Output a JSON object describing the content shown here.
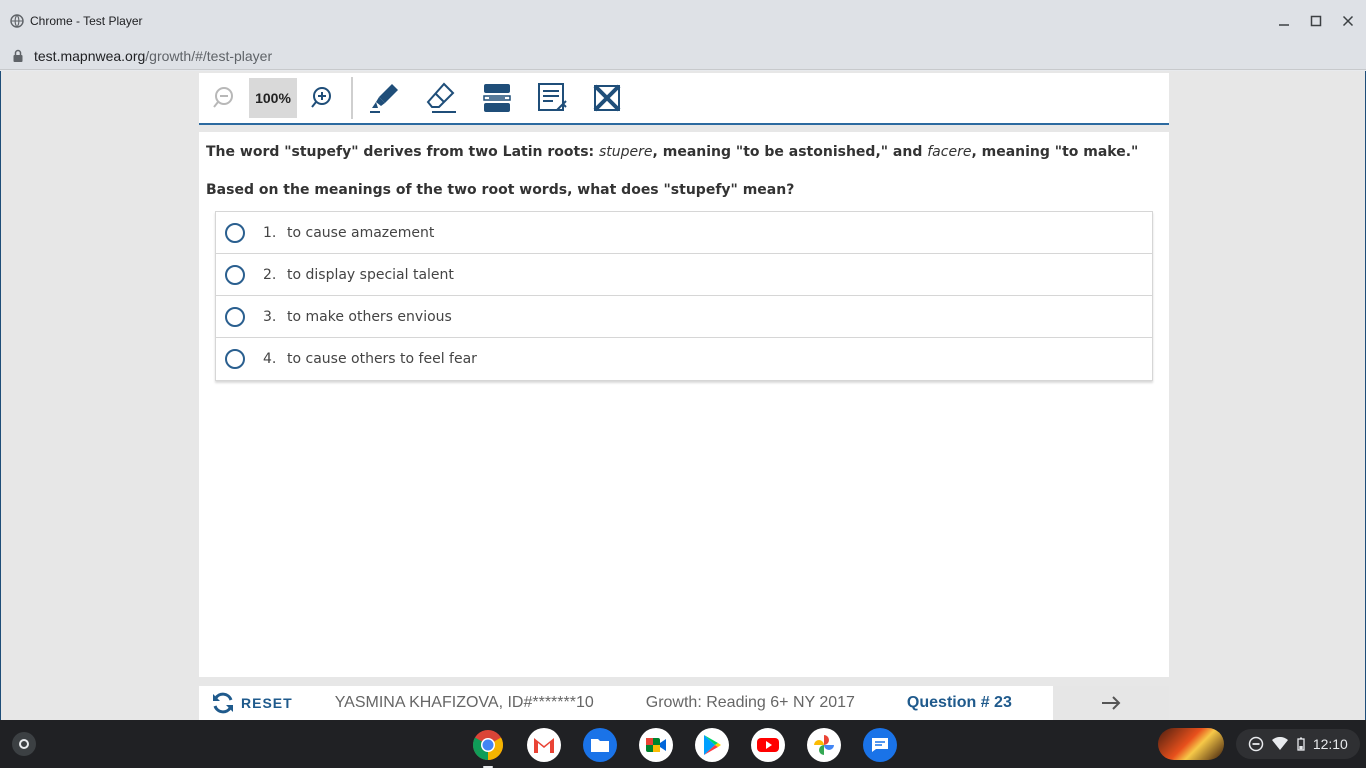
{
  "window": {
    "title": "Chrome - Test Player",
    "url_host": "test.mapnwea.org",
    "url_path": "/growth/#/test-player"
  },
  "toolbar": {
    "zoom_level": "100%",
    "tools": [
      "zoom-out-icon",
      "zoom-in-icon",
      "highlighter-icon",
      "eraser-icon",
      "line-reader-icon",
      "notepad-icon",
      "answer-eliminator-icon"
    ]
  },
  "question": {
    "stem_parts": {
      "p1": "The word \"stupefy\" derives from two Latin roots: ",
      "root1": "stupere",
      "p2": ", meaning \"to be astonished,\" and ",
      "root2": "facere",
      "p3": ", meaning \"to make.\""
    },
    "prompt": "Based on the meanings of the two root words, what does \"stupefy\" mean?",
    "choices": [
      {
        "num": "1.",
        "text": "to cause amazement"
      },
      {
        "num": "2.",
        "text": "to display special talent"
      },
      {
        "num": "3.",
        "text": "to make others envious"
      },
      {
        "num": "4.",
        "text": "to cause others to feel fear"
      }
    ]
  },
  "footer": {
    "reset_label": "RESET",
    "student": "YASMINA KHAFIZOVA, ID#*******10",
    "test_name": "Growth: Reading 6+ NY 2017",
    "question_number": "Question # 23"
  },
  "shelf": {
    "apps": [
      "chrome-icon",
      "gmail-icon",
      "files-icon",
      "meet-icon",
      "play-store-icon",
      "youtube-icon",
      "photos-icon",
      "messages-icon"
    ],
    "time": "12:10"
  },
  "colors": {
    "accent": "#1f5a8c",
    "toolbar_underline": "#2c6aa0"
  }
}
